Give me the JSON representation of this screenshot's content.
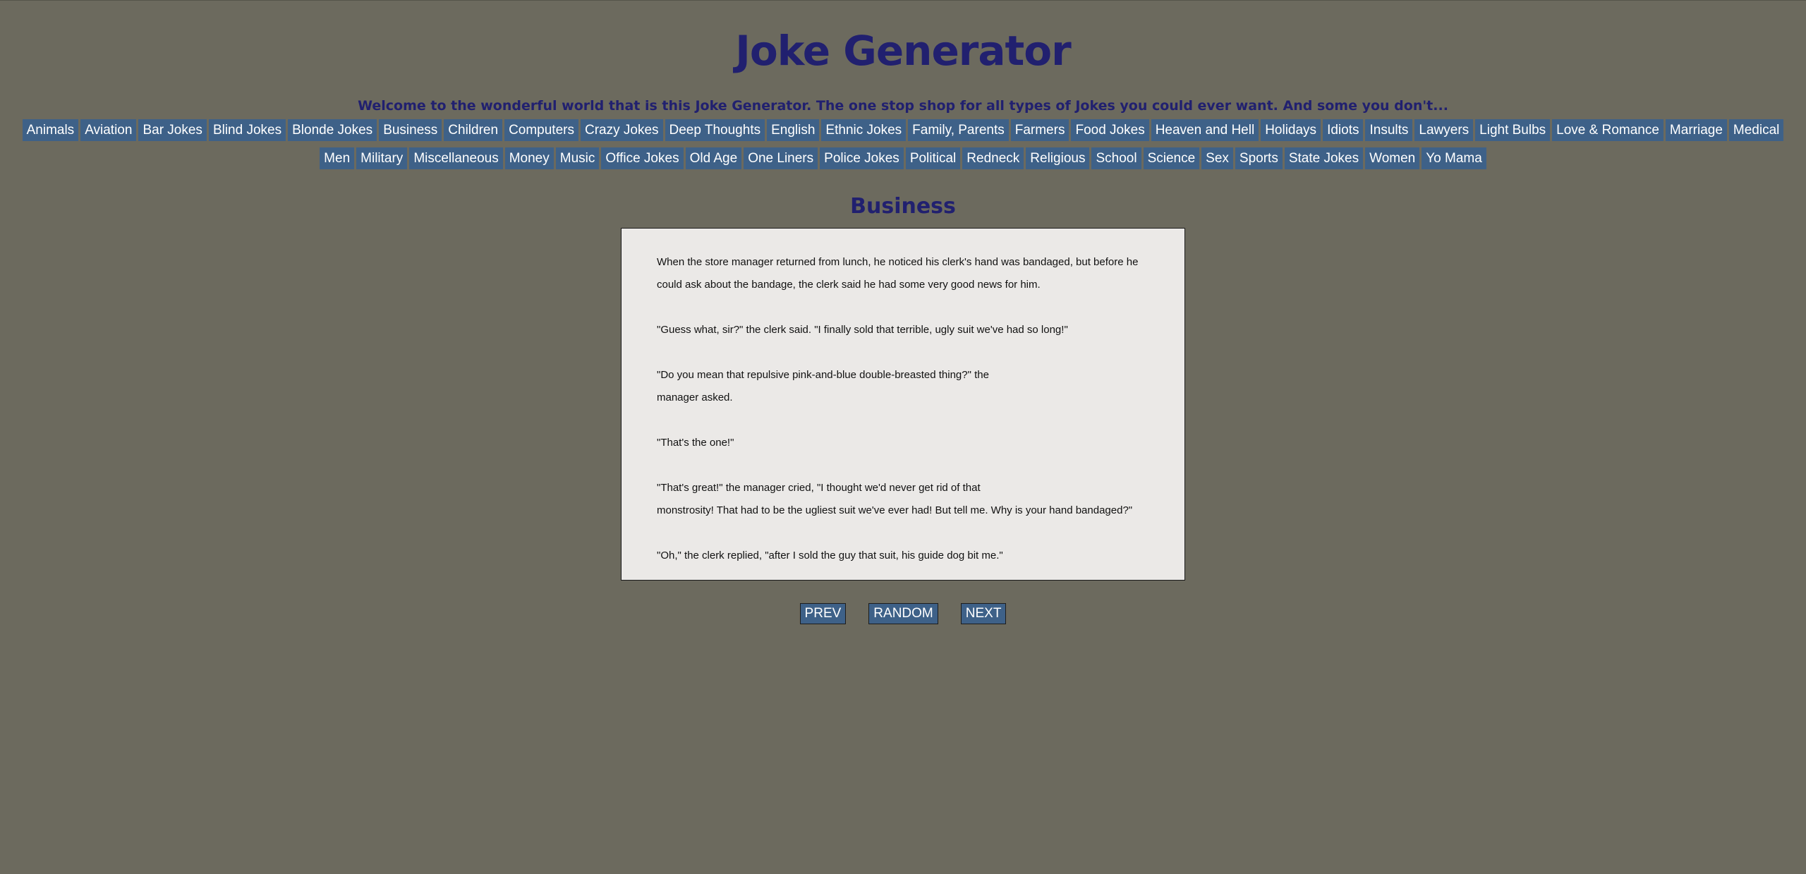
{
  "header": {
    "title": "Joke Generator",
    "welcome": "Welcome to the wonderful world that is this Joke Generator. The one stop shop for all types of Jokes you could ever want. And some you don't..."
  },
  "nav": {
    "row1": [
      "Animals",
      "Aviation",
      "Bar Jokes",
      "Blind Jokes",
      "Blonde Jokes",
      "Business",
      "Children",
      "Computers",
      "Crazy Jokes",
      "Deep Thoughts",
      "English",
      "Ethnic Jokes",
      "Family, Parents",
      "Farmers",
      "Food Jokes",
      "Heaven and Hell",
      "Holidays",
      "Idiots",
      "Insults",
      "Lawyers",
      "Light Bulbs",
      "Love & Romance",
      "Marriage",
      "Medical"
    ],
    "row2": [
      "Men",
      "Military",
      "Miscellaneous",
      "Money",
      "Music",
      "Office Jokes",
      "Old Age",
      "One Liners",
      "Police Jokes",
      "Political",
      "Redneck",
      "Religious",
      "School",
      "Science",
      "Sex",
      "Sports",
      "State Jokes",
      "Women",
      "Yo Mama"
    ]
  },
  "main": {
    "category": "Business",
    "joke": [
      [
        "When the store manager returned from lunch, he noticed his clerk's hand was bandaged, but before he",
        "could ask about the bandage, the clerk said he had some very good news for him."
      ],
      [
        "\"Guess what, sir?\" the clerk said. \"I finally sold that terrible, ugly suit we've had so long!\""
      ],
      [
        "\"Do you mean that repulsive pink-and-blue double-breasted thing?\" the",
        "manager asked."
      ],
      [
        "\"That's the one!\""
      ],
      [
        "\"That's great!\" the manager cried, \"I thought we'd never get rid of that",
        "monstrosity! That had to be the ugliest suit we've ever had! But tell me. Why is your hand bandaged?\""
      ],
      [
        "\"Oh,\" the clerk replied, \"after I sold the guy that suit, his guide dog bit me.\""
      ]
    ]
  },
  "controls": {
    "prev": "PREV",
    "random": "RANDOM",
    "next": "NEXT"
  }
}
